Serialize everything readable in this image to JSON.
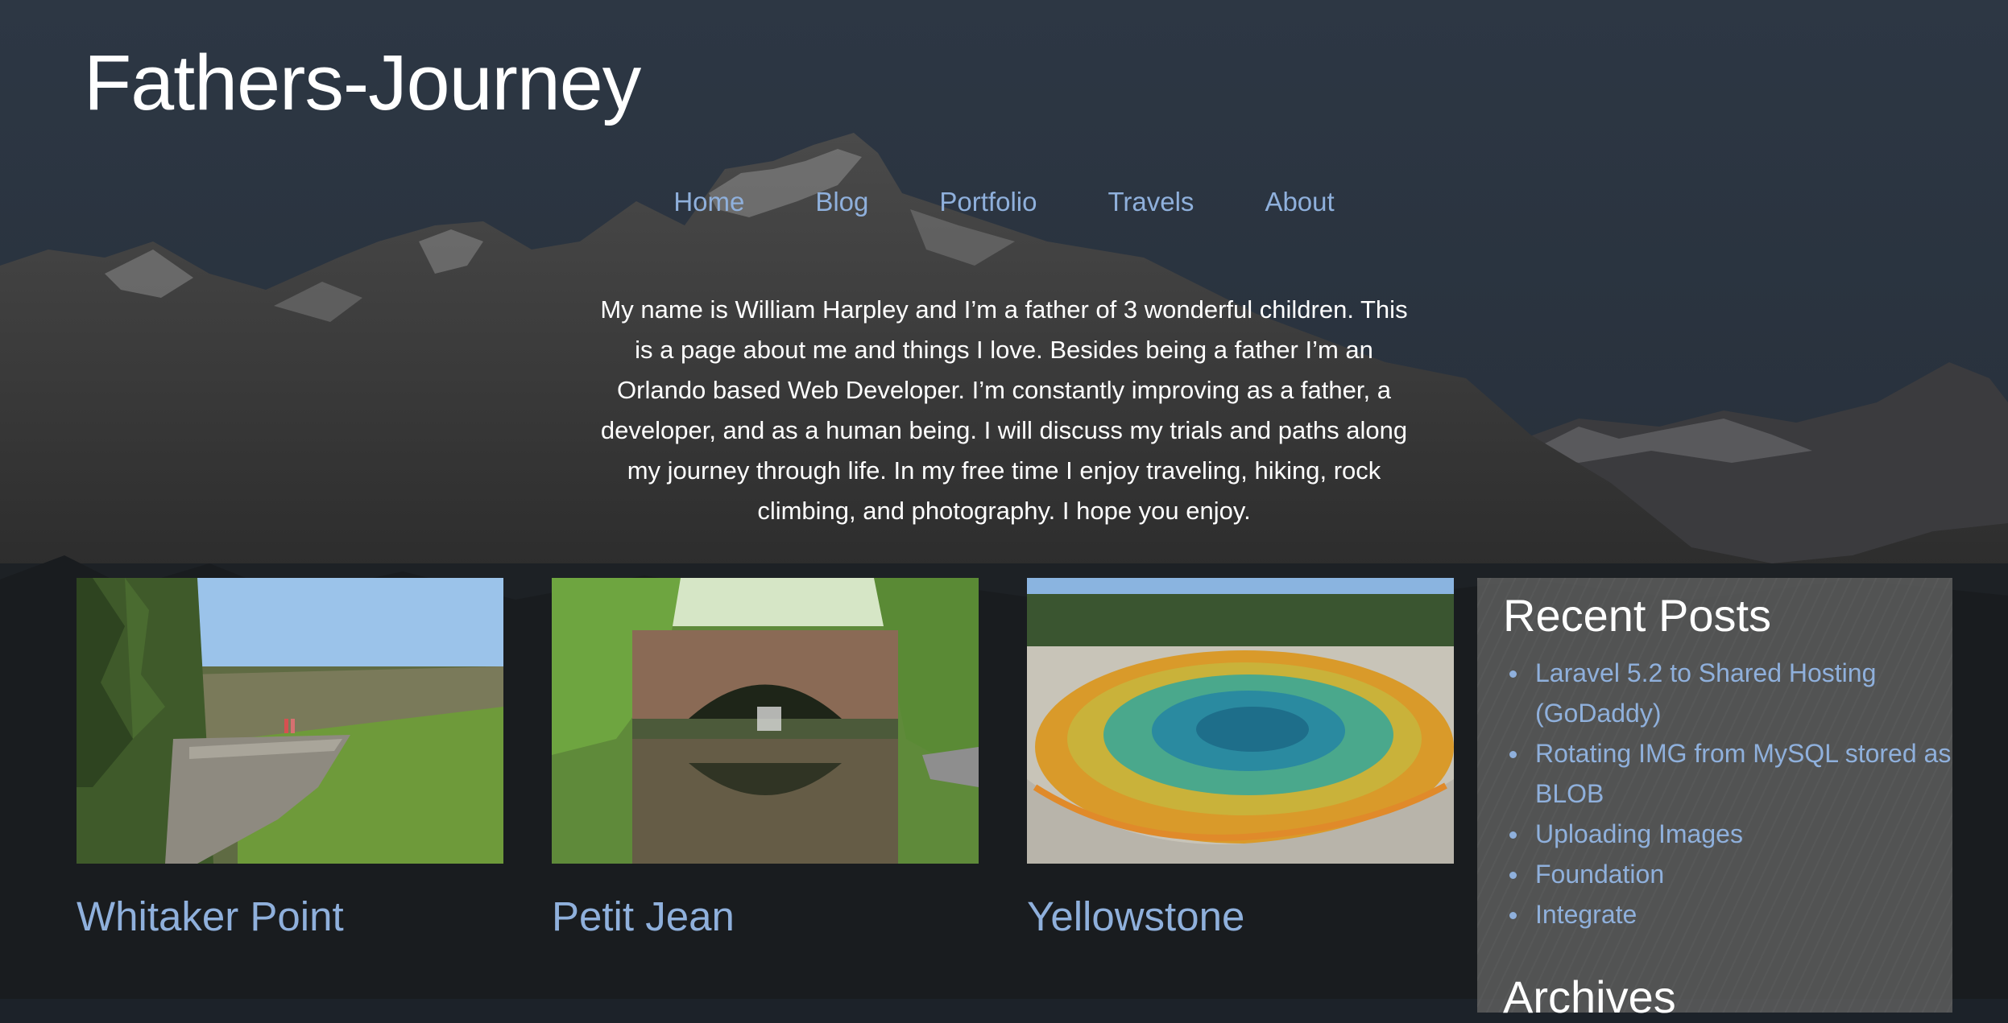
{
  "site": {
    "title": "Fathers-Journey"
  },
  "nav": {
    "items": [
      {
        "label": "Home"
      },
      {
        "label": "Blog"
      },
      {
        "label": "Portfolio"
      },
      {
        "label": "Travels"
      },
      {
        "label": "About"
      }
    ]
  },
  "intro": {
    "text": "My name is William Harpley and I’m a father of 3 wonderful children. This is a page about me and things I love. Besides being a father I’m an Orlando based Web Developer. I’m constantly improving as a father, a developer, and as a human being. I will discuss my trials and paths along my journey through life. In my free time I enjoy traveling, hiking, rock climbing, and photography. I hope you enjoy."
  },
  "cards": [
    {
      "title": "Whitaker Point",
      "image": "cliff-overlook-photo"
    },
    {
      "title": "Petit Jean",
      "image": "stone-bridge-photo"
    },
    {
      "title": "Yellowstone",
      "image": "hot-spring-photo"
    }
  ],
  "sidebar": {
    "recent_heading": "Recent Posts",
    "recent_posts": [
      {
        "label": "Laravel 5.2 to Shared Hosting (GoDaddy)"
      },
      {
        "label": "Rotating IMG from MySQL stored as BLOB"
      },
      {
        "label": "Uploading Images"
      },
      {
        "label": "Foundation"
      },
      {
        "label": "Integrate"
      }
    ],
    "archives_heading": "Archives"
  },
  "colors": {
    "link": "#8fb0dc",
    "header_bg": "#2c3642",
    "sidebar_bg": "#5f5f5f"
  }
}
